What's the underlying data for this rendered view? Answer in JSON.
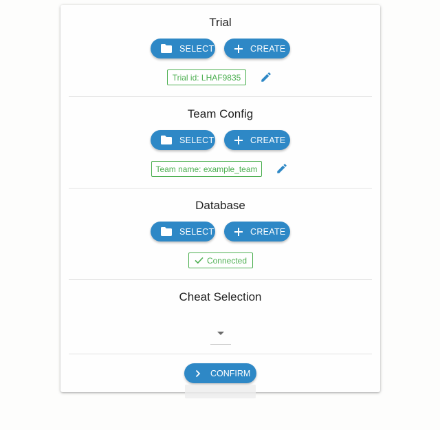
{
  "trial": {
    "title": "Trial",
    "select_label": "SELECT",
    "create_label": "CREATE",
    "chip": "Trial id: LHAF9835"
  },
  "team_config": {
    "title": "Team Config",
    "select_label": "SELECT",
    "create_label": "CREATE",
    "chip": "Team name: example_team"
  },
  "database": {
    "title": "Database",
    "select_label": "SELECT",
    "create_label": "CREATE",
    "chip": "Connected"
  },
  "cheat_selection": {
    "title": "Cheat Selection",
    "selected_value": ""
  },
  "confirm_label": "CONFIRM",
  "colors": {
    "primary": "#2e88c6",
    "success": "#4caf50"
  },
  "icons": {
    "select": "folder-icon",
    "create": "plus-icon",
    "edit": "pencil-icon",
    "connected": "check-icon",
    "confirm": "chevron-right-icon",
    "dropdown": "caret-down-icon"
  }
}
